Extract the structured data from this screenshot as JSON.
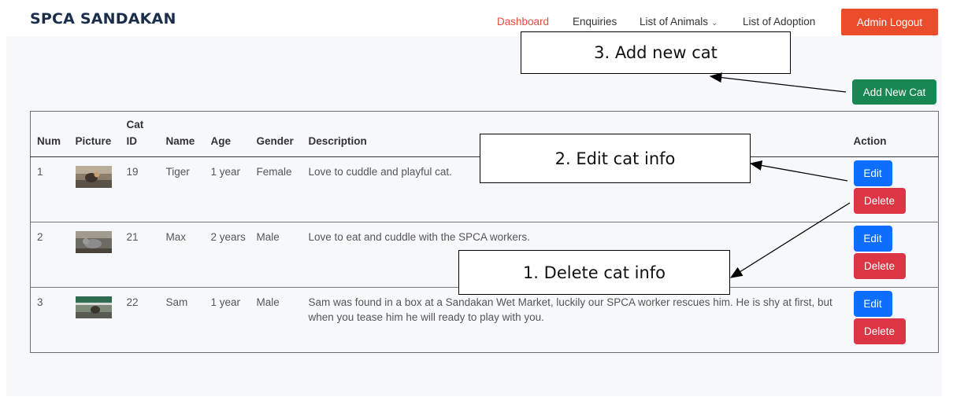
{
  "header": {
    "brand": "SPCA SANDAKAN",
    "nav": [
      {
        "label": "Dashboard",
        "active": true
      },
      {
        "label": "Enquiries"
      },
      {
        "label": "List of Animals",
        "has_dropdown": true
      },
      {
        "label": "List of Adoption"
      }
    ],
    "logout_label": "Admin Logout"
  },
  "actions": {
    "add_label": "Add New Cat"
  },
  "table": {
    "columns": [
      "Num",
      "Picture",
      "Cat ID",
      "Name",
      "Age",
      "Gender",
      "Description",
      "Action"
    ],
    "rows": [
      {
        "num": "1",
        "cat_id": "19",
        "name": "Tiger",
        "age": "1 year",
        "gender": "Female",
        "description": "Love to cuddle and playful cat."
      },
      {
        "num": "2",
        "cat_id": "21",
        "name": "Max",
        "age": "2 years",
        "gender": "Male",
        "description": "Love to eat and cuddle with the SPCA workers."
      },
      {
        "num": "3",
        "cat_id": "22",
        "name": "Sam",
        "age": "1 year",
        "gender": "Male",
        "description": "Sam was found in a box at a Sandakan Wet Market, luckily our SPCA worker rescues him. He is shy at first, but when you tease him he will ready to play with you."
      }
    ],
    "edit_label": "Edit",
    "delete_label": "Delete"
  },
  "annotations": {
    "add": "3.   Add new cat",
    "edit": "2.   Edit cat info",
    "delete": "1.   Delete cat info"
  },
  "colors": {
    "brand": "#1a2e4c",
    "active_nav": "#e84c3d",
    "logout": "#ea4c2c",
    "add": "#198754",
    "edit": "#0d6efd",
    "delete": "#dc3545"
  }
}
